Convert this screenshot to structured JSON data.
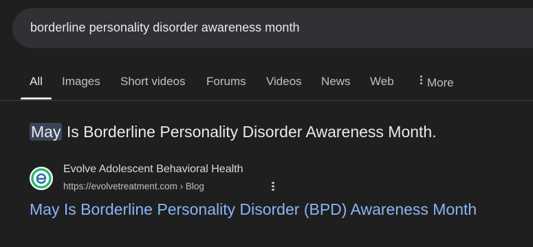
{
  "search": {
    "query": "borderline personality disorder awareness month"
  },
  "tabs": [
    {
      "label": "All",
      "active": true
    },
    {
      "label": "Images"
    },
    {
      "label": "Short videos"
    },
    {
      "label": "Forums"
    },
    {
      "label": "Videos"
    },
    {
      "label": "News"
    },
    {
      "label": "Web"
    },
    {
      "label": "More",
      "icon": "vertical-dots-icon"
    }
  ],
  "featured_snippet": {
    "highlight": "May",
    "rest": " Is Borderline Personality Disorder Awareness Month."
  },
  "result": {
    "favicon_icon": "evolve-e-logo-icon",
    "site_name": "Evolve Adolescent Behavioral Health",
    "url": "https://evolvetreatment.com › Blog",
    "title": "May Is Borderline Personality Disorder (BPD) Awareness Month"
  },
  "colors": {
    "background": "#1f1f1f",
    "search_bar": "#303134",
    "link": "#8ab4f8",
    "highlight": "#394457",
    "text": "#e8eaed",
    "favicon_green": "#2bb673",
    "favicon_blue": "#1e6fa8"
  }
}
